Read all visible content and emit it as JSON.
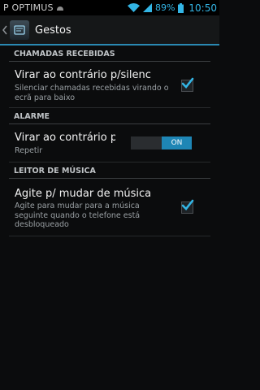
{
  "status_bar": {
    "carrier": "P OPTIMUS",
    "battery_percent": "89%",
    "time": "10:50",
    "accent_color": "#33b5e5",
    "icons": [
      "android-icon",
      "wifi-icon",
      "signal-icon",
      "battery-icon"
    ]
  },
  "action_bar": {
    "title": "Gestos",
    "icons": [
      "back-chevron-icon",
      "gestures-app-icon"
    ]
  },
  "sections": {
    "calls": {
      "header": "CHAMADAS RECEBIDAS",
      "item": {
        "title": "Virar ao contrário p/silenc",
        "summary": "Silenciar chamadas recebidas virando o ecrã para baixo",
        "checked": true
      }
    },
    "alarm": {
      "header": "ALARME",
      "item": {
        "title": "Virar ao contrário p/a",
        "summary": "Repetir",
        "toggle_label": "ON",
        "toggle_on": true
      }
    },
    "music": {
      "header": "LEITOR DE MÚSICA",
      "item": {
        "title": "Agite p/ mudar de música",
        "summary": "Agite para mudar para a música seguinte quando o telefone está desbloqueado",
        "checked": true
      }
    }
  }
}
